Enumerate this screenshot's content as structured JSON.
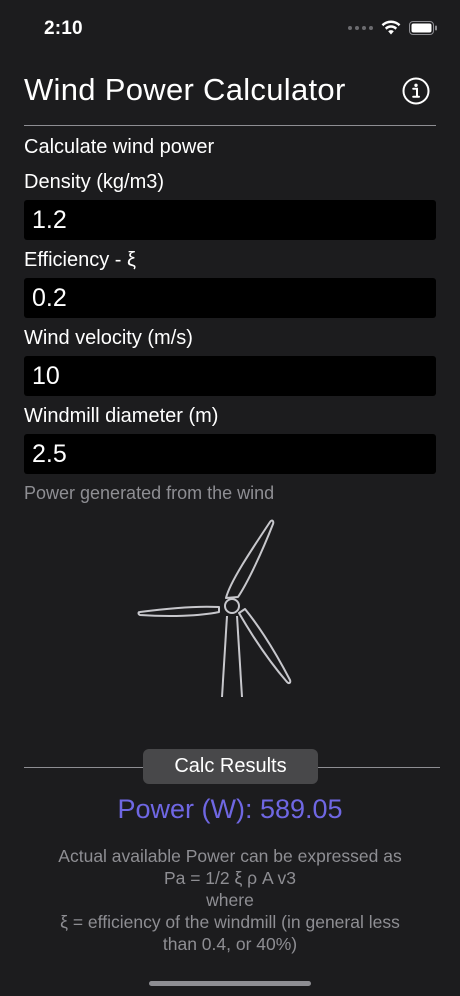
{
  "status_bar": {
    "time": "2:10"
  },
  "nav": {
    "title": "Wind Power Calculator",
    "info_icon": "info-circle-icon"
  },
  "form": {
    "section_label": "Calculate wind power",
    "fields": [
      {
        "label": "Density (kg/m3)",
        "value": "1.2"
      },
      {
        "label": "Efficiency - ξ",
        "value": "0.2"
      },
      {
        "label": "Wind velocity (m/s)",
        "value": "10"
      },
      {
        "label": "Windmill diameter (m)",
        "value": "2.5"
      }
    ],
    "hint": "Power generated from the wind"
  },
  "results": {
    "button_label": "Calc Results",
    "power_text": "Power (W): 589.05",
    "explanation_lines": [
      "Actual available Power can be expressed as",
      "Pa = 1/2 ξ ρ A v3",
      "where",
      "ξ = efficiency of the windmill (in general less",
      "than 0.4, or 40%)"
    ]
  },
  "colors": {
    "background": "#1c1c1e",
    "field_background": "#000000",
    "accent_result": "#6f67e3",
    "secondary_text": "#8e8e93",
    "button_background": "#48484a"
  }
}
